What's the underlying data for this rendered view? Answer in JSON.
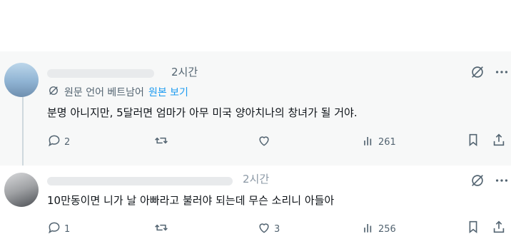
{
  "tweets": [
    {
      "time": "2시간",
      "translate": {
        "label": "원문 언어 베트남어",
        "view_original": "원본 보기"
      },
      "text": "분명 아니지만, 5달러면 엄마가 아무 미국 양아치나의 창녀가 될 거야.",
      "stats": {
        "replies": "2",
        "reposts": "",
        "likes": "",
        "views": "261"
      }
    },
    {
      "time": "2시간",
      "text": "10만동이면 니가 날 아빠라고 불러야 되는데 무슨 소리니 아들아",
      "stats": {
        "replies": "1",
        "reposts": "",
        "likes": "3",
        "views": "256"
      }
    }
  ],
  "icons": {
    "reply": "reply-icon",
    "repost": "repost-icon",
    "like": "heart-icon",
    "views": "views-icon",
    "bookmark": "bookmark-icon",
    "share": "share-icon",
    "grok": "grok-icon",
    "more": "more-icon",
    "translate": "translate-icon"
  },
  "colors": {
    "text": "#0f1419",
    "muted": "#536471",
    "link": "#1d9bf0",
    "highlight_bg": "#f7f8f8"
  }
}
